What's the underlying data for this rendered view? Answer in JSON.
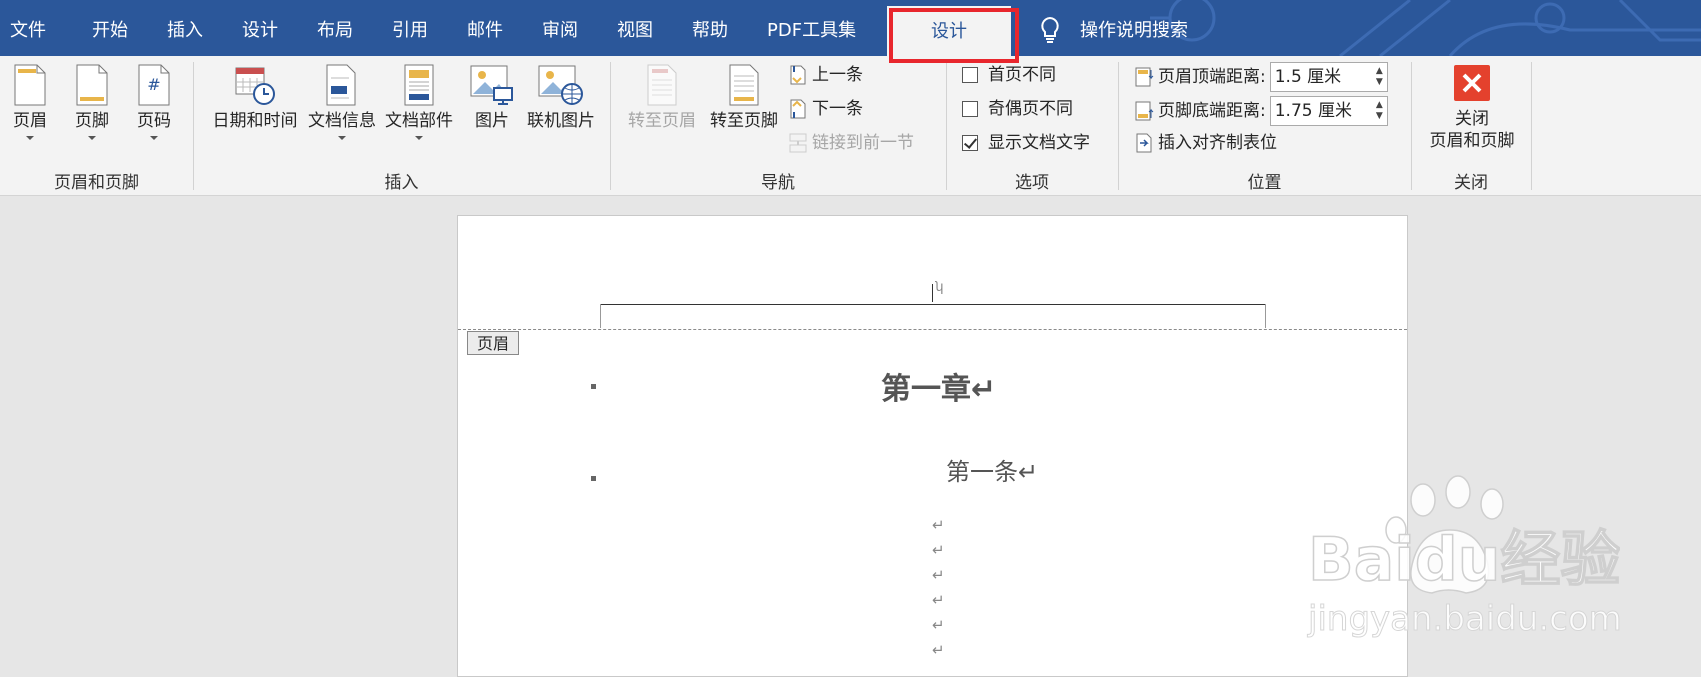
{
  "menu": {
    "tabs": [
      "文件",
      "开始",
      "插入",
      "设计",
      "布局",
      "引用",
      "邮件",
      "审阅",
      "视图",
      "帮助",
      "PDF工具集"
    ],
    "active_tab": "设计",
    "tell_me": "操作说明搜索"
  },
  "ribbon": {
    "groups": {
      "header_footer": {
        "label": "页眉和页脚",
        "header": "页眉",
        "footer": "页脚",
        "page_number": "页码"
      },
      "insert": {
        "label": "插入",
        "date_time": "日期和时间",
        "doc_info": "文档信息",
        "doc_parts": "文档部件",
        "picture": "图片",
        "online_picture": "联机图片"
      },
      "navigation": {
        "label": "导航",
        "goto_header": "转至页眉",
        "goto_footer": "转至页脚",
        "previous": "上一条",
        "next": "下一条",
        "link_previous": "链接到前一节"
      },
      "options": {
        "label": "选项",
        "different_first": "首页不同",
        "different_odd_even": "奇偶页不同",
        "show_doc_text": "显示文档文字",
        "checked": [
          false,
          false,
          true
        ]
      },
      "position": {
        "label": "位置",
        "header_top_label": "页眉顶端距离:",
        "header_top_value": "1.5 厘米",
        "footer_bottom_label": "页脚底端距离:",
        "footer_bottom_value": "1.75 厘米",
        "insert_align_tab": "插入对齐制表位"
      },
      "close": {
        "label": "关闭",
        "close_line1": "关闭",
        "close_line2": "页眉和页脚"
      }
    }
  },
  "document": {
    "header_tag": "页眉",
    "chapter": "第一章↵",
    "article": "第一条↵",
    "para_mark": "↵",
    "header_mark": "ʮ"
  },
  "watermark": {
    "brand": "Baidu经验",
    "url": "jingyan.baidu.com"
  },
  "colors": {
    "tabbar": "#2b579a",
    "highlight": "#e8262d",
    "close_red": "#e4412d"
  }
}
